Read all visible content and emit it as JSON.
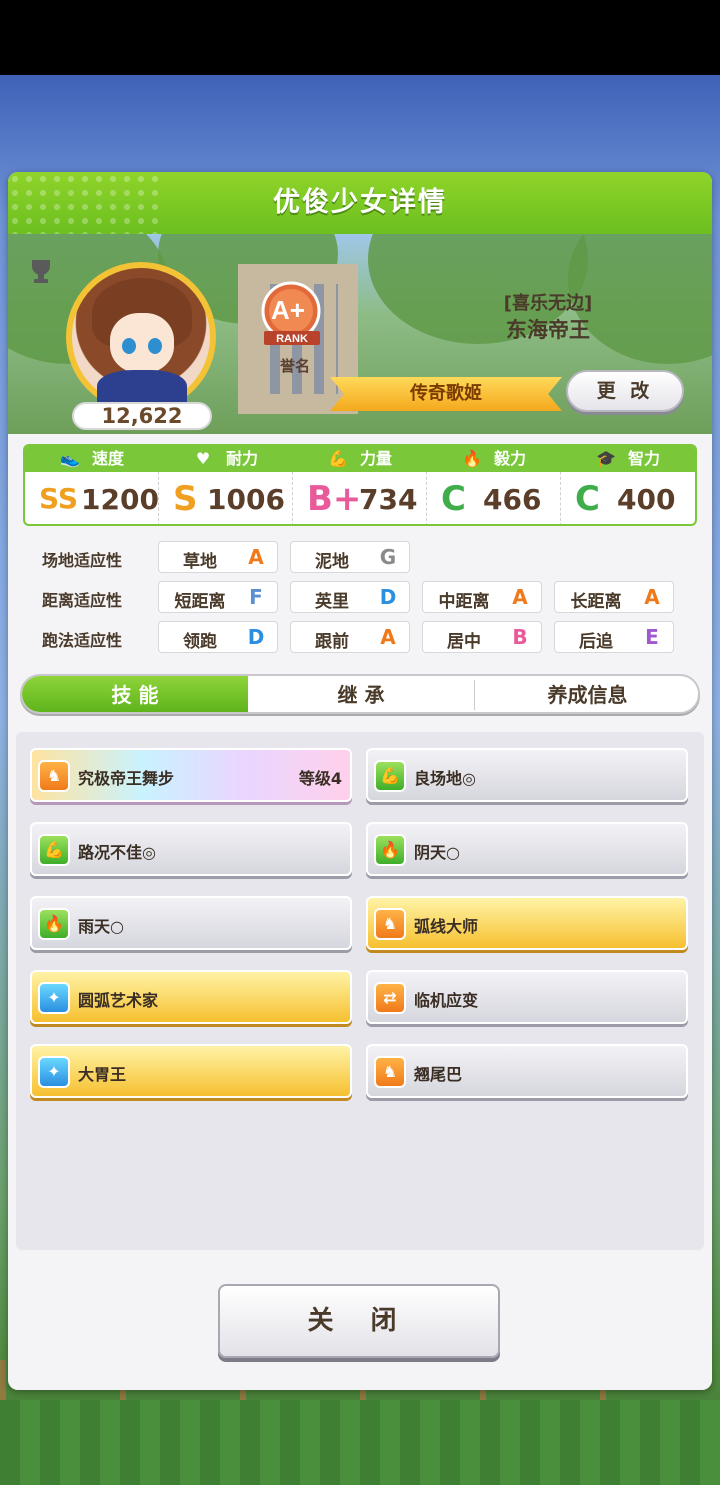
{
  "dialog": {
    "title": "优俊少女详情",
    "character": {
      "fans": "12,622",
      "rank": "A+",
      "rank_word": "RANK",
      "rank_caption": "誉名",
      "epithet": "[喜乐无边]",
      "name": "东海帝王",
      "title": "传奇歌姬",
      "change_label": "更 改"
    },
    "stats": [
      {
        "label": "速度",
        "grade": "SS",
        "value": "1200",
        "icon": "shoe-icon"
      },
      {
        "label": "耐力",
        "grade": "S",
        "value": "1006",
        "icon": "heart-icon"
      },
      {
        "label": "力量",
        "grade": "B+",
        "value": "734",
        "icon": "muscle-icon"
      },
      {
        "label": "毅力",
        "grade": "C",
        "value": "466",
        "icon": "flame-icon"
      },
      {
        "label": "智力",
        "grade": "C",
        "value": "400",
        "icon": "graduation-cap-icon"
      }
    ],
    "aptitudes": {
      "track": {
        "label": "场地适应性",
        "items": [
          {
            "name": "草地",
            "grade": "A"
          },
          {
            "name": "泥地",
            "grade": "G"
          }
        ]
      },
      "distance": {
        "label": "距离适应性",
        "items": [
          {
            "name": "短距离",
            "grade": "F"
          },
          {
            "name": "英里",
            "grade": "D"
          },
          {
            "name": "中距离",
            "grade": "A"
          },
          {
            "name": "长距离",
            "grade": "A"
          }
        ]
      },
      "strategy": {
        "label": "跑法适应性",
        "items": [
          {
            "name": "领跑",
            "grade": "D"
          },
          {
            "name": "跟前",
            "grade": "A"
          },
          {
            "name": "居中",
            "grade": "B"
          },
          {
            "name": "后追",
            "grade": "E"
          }
        ]
      }
    },
    "tabs": [
      "技 能",
      "继 承",
      "养成信息"
    ],
    "skills": [
      {
        "name": "究极帝王舞步",
        "level": "等级4",
        "style": "rainbow",
        "icon": "running-horse-icon"
      },
      {
        "name": "良场地◎",
        "level": "",
        "style": "plain",
        "icon": "muscle-icon"
      },
      {
        "name": "路况不佳◎",
        "level": "",
        "style": "plain",
        "icon": "muscle-icon"
      },
      {
        "name": "阴天○",
        "level": "",
        "style": "plain",
        "icon": "flame-icon"
      },
      {
        "name": "雨天○",
        "level": "",
        "style": "plain",
        "icon": "flame-icon"
      },
      {
        "name": "弧线大师",
        "level": "",
        "style": "gold",
        "icon": "running-horse-icon"
      },
      {
        "name": "圆弧艺术家",
        "level": "",
        "style": "gold",
        "icon": "sparkle-icon"
      },
      {
        "name": "临机应变",
        "level": "",
        "style": "plain",
        "icon": "swap-arrows-icon"
      },
      {
        "name": "大胃王",
        "level": "",
        "style": "gold",
        "icon": "sparkle-icon"
      },
      {
        "name": "翘尾巴",
        "level": "",
        "style": "plain",
        "icon": "running-horse-icon"
      }
    ],
    "close_label": "关 闭"
  },
  "colors": {
    "accent_green": "#7ac83a",
    "grade_SS": "#f0a020",
    "grade_S": "#f0a020",
    "grade_B": "#e85a9a",
    "grade_C": "#3fae4a",
    "grade_A": "#f07a1a",
    "grade_D": "#2a8fe0",
    "grade_E": "#a058d0",
    "grade_F": "#5a8fd0",
    "grade_G": "#8a8a8a"
  }
}
